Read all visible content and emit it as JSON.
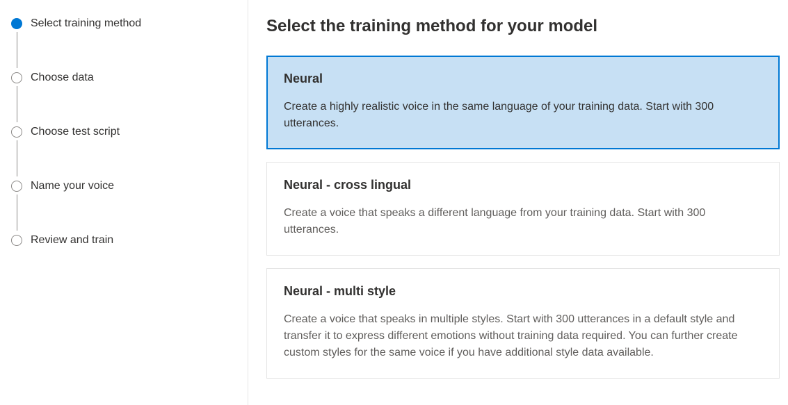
{
  "sidebar": {
    "steps": [
      {
        "label": "Select training method",
        "active": true
      },
      {
        "label": "Choose data",
        "active": false
      },
      {
        "label": "Choose test script",
        "active": false
      },
      {
        "label": "Name your voice",
        "active": false
      },
      {
        "label": "Review and train",
        "active": false
      }
    ]
  },
  "main": {
    "title": "Select the training method for your model",
    "options": [
      {
        "title": "Neural",
        "description": "Create a highly realistic voice in the same language of your training data. Start with 300 utterances.",
        "selected": true
      },
      {
        "title": "Neural - cross lingual",
        "description": "Create a voice that speaks a different language from your training data. Start with 300 utterances.",
        "selected": false
      },
      {
        "title": "Neural - multi style",
        "description": "Create a voice that speaks in multiple styles. Start with 300 utterances in a default style and transfer it to express different emotions without training data required. You can further create custom styles for the same voice if you have additional style data available.",
        "selected": false
      }
    ]
  }
}
